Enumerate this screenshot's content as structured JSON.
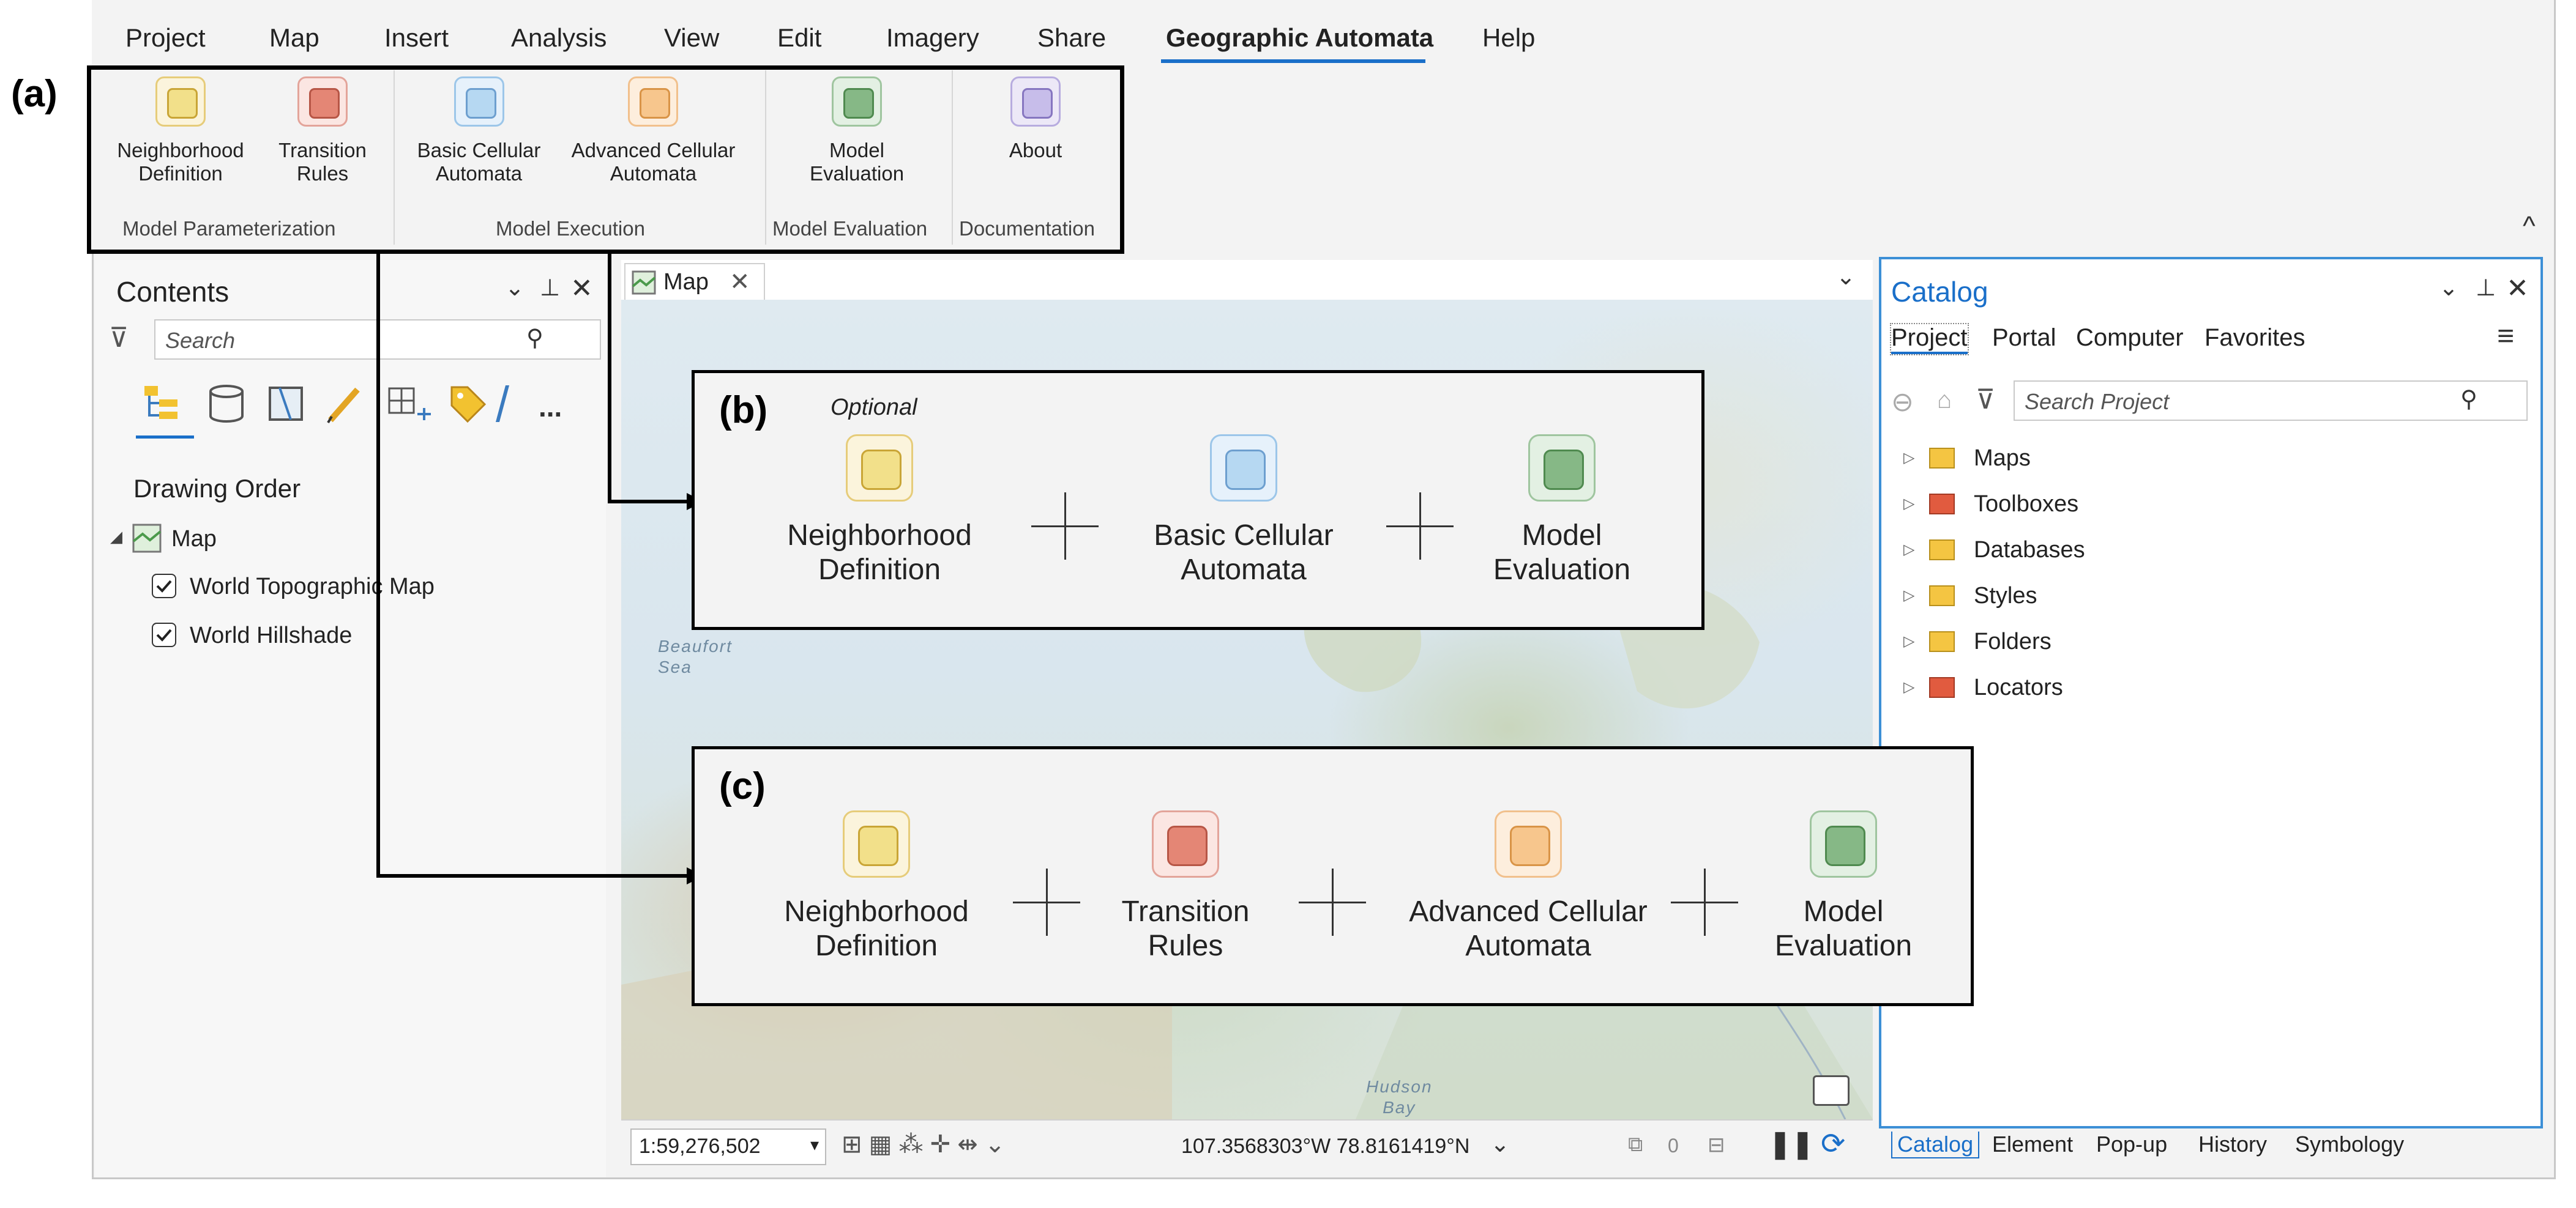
{
  "panel_labels": {
    "a": "(a)",
    "b": "(b)",
    "c": "(c)"
  },
  "menu": {
    "tabs": [
      "Project",
      "Map",
      "Insert",
      "Analysis",
      "View",
      "Edit",
      "Imagery",
      "Share",
      "Geographic Automata",
      "Help"
    ],
    "active_tab": "Geographic Automata"
  },
  "ribbon": {
    "buttons": [
      {
        "label": "Neighborhood\nDefinition",
        "icon": "neighborhood-definition-icon",
        "color": "#f2e08a"
      },
      {
        "label": "Transition\nRules",
        "icon": "transition-rules-icon",
        "color": "#e48675"
      },
      {
        "label": "Basic Cellular\nAutomata",
        "icon": "basic-cellular-automata-icon",
        "color": "#b6d8f2"
      },
      {
        "label": "Advanced Cellular\nAutomata",
        "icon": "advanced-cellular-automata-icon",
        "color": "#f7c68d"
      },
      {
        "label": "Model\nEvaluation",
        "icon": "model-evaluation-icon",
        "color": "#86b886"
      },
      {
        "label": "About",
        "icon": "about-icon",
        "color": "#c7bdea"
      }
    ],
    "groups": [
      "Model Parameterization",
      "Model Execution",
      "Model Evaluation",
      "Documentation"
    ],
    "collapse_glyph": "^"
  },
  "contents": {
    "title": "Contents",
    "search_placeholder": "Search",
    "more_glyph": "...",
    "section": "Drawing Order",
    "map_name": "Map",
    "layers": [
      "World Topographic Map",
      "World Hillshade"
    ]
  },
  "map_view": {
    "tab": "Map",
    "labels": {
      "sea": "Beaufort\nSea",
      "bay": "Hudson\nBay"
    },
    "scale": "1:59,276,502",
    "coordinates": "107.3568303°W 78.8161419°N",
    "selection_count": "0"
  },
  "catalog": {
    "title": "Catalog",
    "tabs": [
      "Project",
      "Portal",
      "Computer",
      "Favorites"
    ],
    "search_placeholder": "Search Project",
    "items": [
      "Maps",
      "Toolboxes",
      "Databases",
      "Styles",
      "Folders",
      "Locators"
    ],
    "bottom_tabs": [
      "Catalog",
      "Element",
      "Pop-up",
      "History",
      "Symbology"
    ]
  },
  "workflow_b": {
    "note": "Optional",
    "steps": [
      "Neighborhood\nDefinition",
      "Basic Cellular\nAutomata",
      "Model\nEvaluation"
    ]
  },
  "workflow_c": {
    "steps": [
      "Neighborhood\nDefinition",
      "Transition\nRules",
      "Advanced Cellular\nAutomata",
      "Model\nEvaluation"
    ]
  }
}
